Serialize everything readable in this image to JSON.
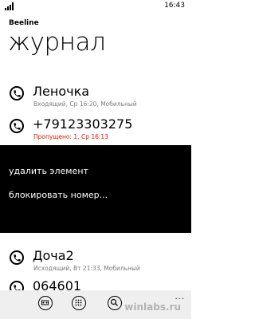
{
  "status_bar": {
    "time": "16:43",
    "signal_icon": "signal-strength-icon"
  },
  "app": {
    "name": "Beeline",
    "title": "журнал"
  },
  "call_log": [
    {
      "name": "Леночка",
      "detail": "Входящий, Ср 16:20, Мобильный",
      "missed": false,
      "icon": "phone-icon"
    },
    {
      "name": "+79123303275",
      "detail": "Пропущено: 1, Ср 16:13",
      "missed": true,
      "icon": "phone-icon"
    },
    {
      "name": "Доча2",
      "detail": "Исходящий, Вт 21:33, Мобильный",
      "missed": false,
      "icon": "phone-icon"
    },
    {
      "name": "064601",
      "detail": "",
      "missed": false,
      "icon": "phone-icon"
    }
  ],
  "context_menu": {
    "items": [
      "удалить элемент",
      "блокировать номер..."
    ]
  },
  "app_bar": {
    "buttons": [
      {
        "name": "voicemail",
        "icon": "voicemail-icon"
      },
      {
        "name": "keypad",
        "icon": "keypad-icon"
      },
      {
        "name": "contacts-search",
        "icon": "search-icon"
      }
    ],
    "more": "..."
  },
  "watermark": "winlabs.ru",
  "colors": {
    "missed": "#e51400",
    "secondary_text": "#7a7a7a",
    "menu_background": "#000000",
    "app_bar": "#efefef"
  }
}
